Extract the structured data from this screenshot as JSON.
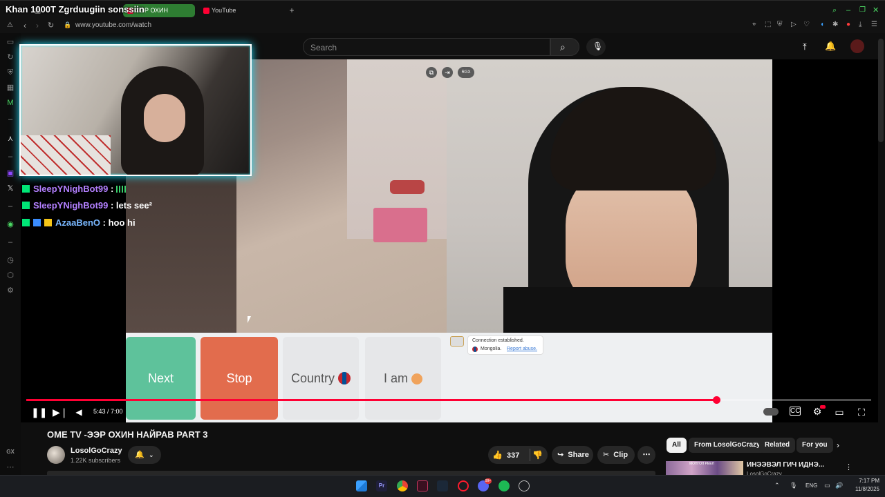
{
  "browser": {
    "tabs": [
      {
        "label": "",
        "color": "#6b6b6b"
      },
      {
        "label": "ЭЭР ОХИН",
        "color": "#2e7d32"
      },
      {
        "label": "YouTube",
        "color": "#ff0033"
      }
    ],
    "url": "www.youtube.com/watch",
    "sidebar_icons": [
      "warning-icon",
      "twitch-icon",
      "reload-icon",
      "shield-icon",
      "calendar-icon",
      "m-icon",
      "hyperlink-icon",
      "twitch-purple-icon",
      "x-icon",
      "play-icon",
      "clock-icon",
      "cube-icon",
      "settings-icon",
      "gx-icon",
      "more-icon"
    ],
    "gx_label": "GX"
  },
  "stream_overlay": {
    "title": "Khan 1000T Zgrduugiin sonssiin"
  },
  "youtube": {
    "search_placeholder": "Search",
    "ome": {
      "next_label": "Next",
      "stop_label": "Stop",
      "country_label": "Country",
      "iam_label": "I am",
      "connection_text": "Connection established.",
      "country_name": "Mongolia.",
      "report_text": "Report abuse.",
      "icon_labels": [
        "RGX"
      ]
    },
    "chat": [
      {
        "user": "SleepYNighBot99",
        "message": "",
        "user_color": "#b380ff"
      },
      {
        "user": "SleepYNighBot99",
        "message": "lets see²",
        "user_color": "#b380ff"
      },
      {
        "user": "AzaaBenO",
        "message": "hoo hi",
        "user_color": "#7ab8ff"
      }
    ],
    "player": {
      "time": "5:43 / 7:00",
      "progress": 0.817
    },
    "video_title": "OME TV -ЭЭР ОХИН НАЙРАВ PART 3",
    "channel": {
      "name": "LosolGoCrazy",
      "subscribers": "1.22K subscribers"
    },
    "actions": {
      "likes": "337",
      "share": "Share",
      "clip": "Clip"
    },
    "chips": [
      "All",
      "From LosolGoCrazy",
      "Related",
      "For you"
    ],
    "related": {
      "title": "ИНЭЭВЭЛ ГИЧ ИДНЭ...",
      "channel": "LosolGoCrazy",
      "thumb_text": "МОНГОЛ РЕЕЛ"
    }
  },
  "taskbar": {
    "lang": "ENG",
    "time": "7:17 PM",
    "date": "11/8/2025",
    "discord_badge": "99+"
  }
}
